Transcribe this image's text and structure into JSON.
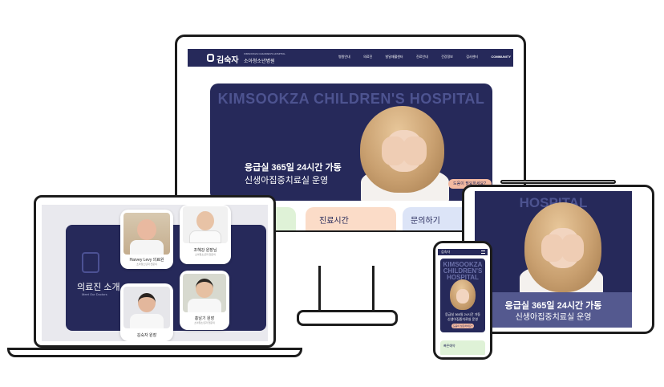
{
  "site": {
    "logo_name": "김숙자",
    "logo_sub_en": "KIMSOOKZA CHILDREN'S HOSPITAL",
    "logo_sub_ko": "소아청소년병원",
    "nav": [
      "병원안내",
      "의료진",
      "발달재활센터",
      "진료안내",
      "건강정보",
      "검사센터",
      "COMMUNITY"
    ]
  },
  "hero": {
    "title_en": "KIMSOOKZA CHILDREN'S HOSPITAL",
    "title_en_tablet": "HOSPITAL",
    "title_en_mobile": "KIMSOOKZA CHILDREN'S HOSPITAL",
    "line1": "응급실 365일 24시간 가동",
    "line2": "신생아집중치료실 운영",
    "help_button": "도움이 필요하세요?"
  },
  "quick_cards": [
    {
      "label": "",
      "color": "#dff2d7"
    },
    {
      "label": "진료시간",
      "color": "#fbdcc8"
    },
    {
      "label": "문의하기",
      "color": "#dce4f7"
    }
  ],
  "doctors_section": {
    "title": "의료진 소개",
    "subtitle": "Meet Our Doctors",
    "doctors": [
      {
        "name": "Harvey Levy 의료원",
        "desc": "소아청소년과 전문의"
      },
      {
        "name": "조혜강 원장님",
        "desc": "소아청소년과 전문의"
      },
      {
        "name": "김숙자 원장",
        "desc": ""
      },
      {
        "name": "홍남기 원장",
        "desc": "소아청소년과 전문의"
      }
    ]
  },
  "mobile": {
    "logo": "김숙자",
    "card_label": "빠른예약"
  },
  "colors": {
    "navy": "#26295a",
    "accent": "#f2b9a1"
  }
}
